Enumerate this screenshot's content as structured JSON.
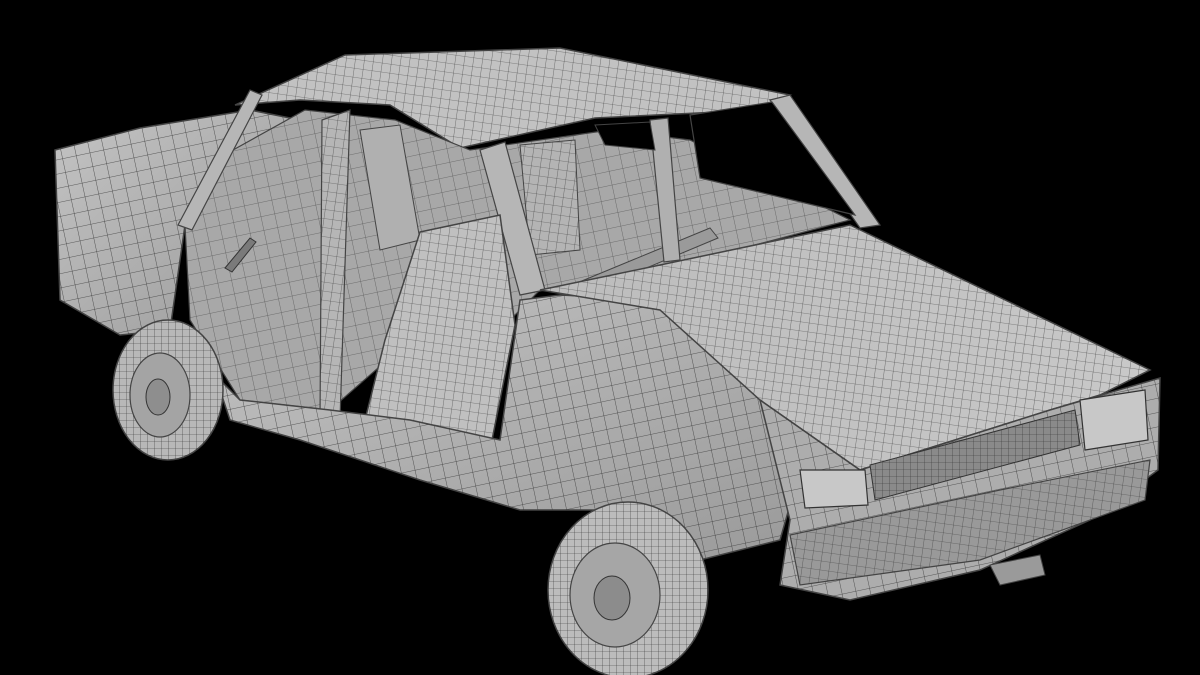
{
  "viewport": {
    "background": "#000000",
    "mesh_fill": "#b8b8b8",
    "mesh_shade": "#8e8e8e",
    "mesh_dark": "#5a5a5a",
    "wire_color": "#3a3a3a",
    "interior_fill": "#a6a6a6"
  },
  "model": {
    "icon": "wireframe-car-icon"
  }
}
